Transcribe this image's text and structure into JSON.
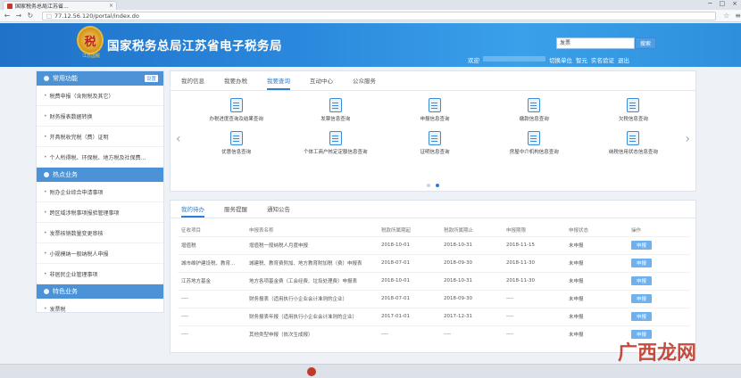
{
  "browser": {
    "tab_title": "国家税务总局江苏省...",
    "url": "77.12.56.120/portal/index.do",
    "controls": [
      "─",
      "□",
      "×"
    ]
  },
  "header": {
    "emblem_char": "税",
    "emblem_sub": "江苏国税",
    "site_title": "国家税务总局江苏省电子税务局",
    "search_value": "发票",
    "search_button": "搜索",
    "links": [
      "欢迎",
      "切换单位",
      "智元",
      "实名验证",
      "退出"
    ]
  },
  "sidebar": {
    "sections": [
      {
        "title": "常用功能",
        "setting": "设置",
        "items": [
          "税费申报（含附税及其它）",
          "财务报表数据转换",
          "开具税收完税（费）证明",
          "个人所得税、环保税、地方税及社保费..."
        ]
      },
      {
        "title": "热点业务",
        "items": [
          "附办企业综合申请事项",
          "跨区域涉税事项报验管理事项",
          "发票核销数量变更审核",
          "小规模纳一般纳税人申报",
          "非居民企业管理事项"
        ]
      },
      {
        "title": "特色业务",
        "items": [
          "发票税"
        ]
      }
    ]
  },
  "main_tabs": [
    "我的信息",
    "我要办税",
    "我要查询",
    "互动中心",
    "公众服务"
  ],
  "main_active_tab": "我要查询",
  "query_items": [
    "办税进度查询及结果查询",
    "发票信息查询",
    "申报信息查询",
    "缴款信息查询",
    "欠税信息查询",
    "优惠信息查询",
    "个体工商户核定定额信息查询",
    "证明信息查询",
    "房屋中介机构信息查询",
    "纳税信用状态信息查询"
  ],
  "bottom_tabs": [
    "我的待办",
    "服务提醒",
    "通知公告"
  ],
  "bottom_active_tab": "我的待办",
  "table": {
    "headers": [
      "征收项目",
      "申报表名称",
      "税款所属期起",
      "税款所属期止",
      "申报期限",
      "申报状态",
      "操作"
    ],
    "rows": [
      [
        "增值税",
        "增值税一般纳税人月度申报",
        "2018-10-01",
        "2018-10-31",
        "2018-11-15",
        "未申报",
        "申报"
      ],
      [
        "城市维护建设税、教育...",
        "城建税、教育费附加、地方教育附加税（费）申报表",
        "2018-07-01",
        "2018-09-30",
        "2018-11-30",
        "未申报",
        "申报"
      ],
      [
        "江苏地方基金",
        "地方各项基金费（工会经费、垃圾处理费）申报表",
        "2018-10-01",
        "2018-10-31",
        "2018-11-30",
        "未申报",
        "申报"
      ],
      [
        "----",
        "财务报表（适用执行小企业会计准则的企业）",
        "2018-07-01",
        "2018-09-30",
        "----",
        "未申报",
        "申报"
      ],
      [
        "----",
        "财务报表年报（适用执行小企业会计准则的企业）",
        "2017-01-01",
        "2017-12-31",
        "----",
        "未申报",
        "申报"
      ],
      [
        "----",
        "其他类型申报（依次生成报）",
        "----",
        "----",
        "----",
        "未申报",
        "申报"
      ]
    ]
  },
  "watermark": "广西龙网"
}
